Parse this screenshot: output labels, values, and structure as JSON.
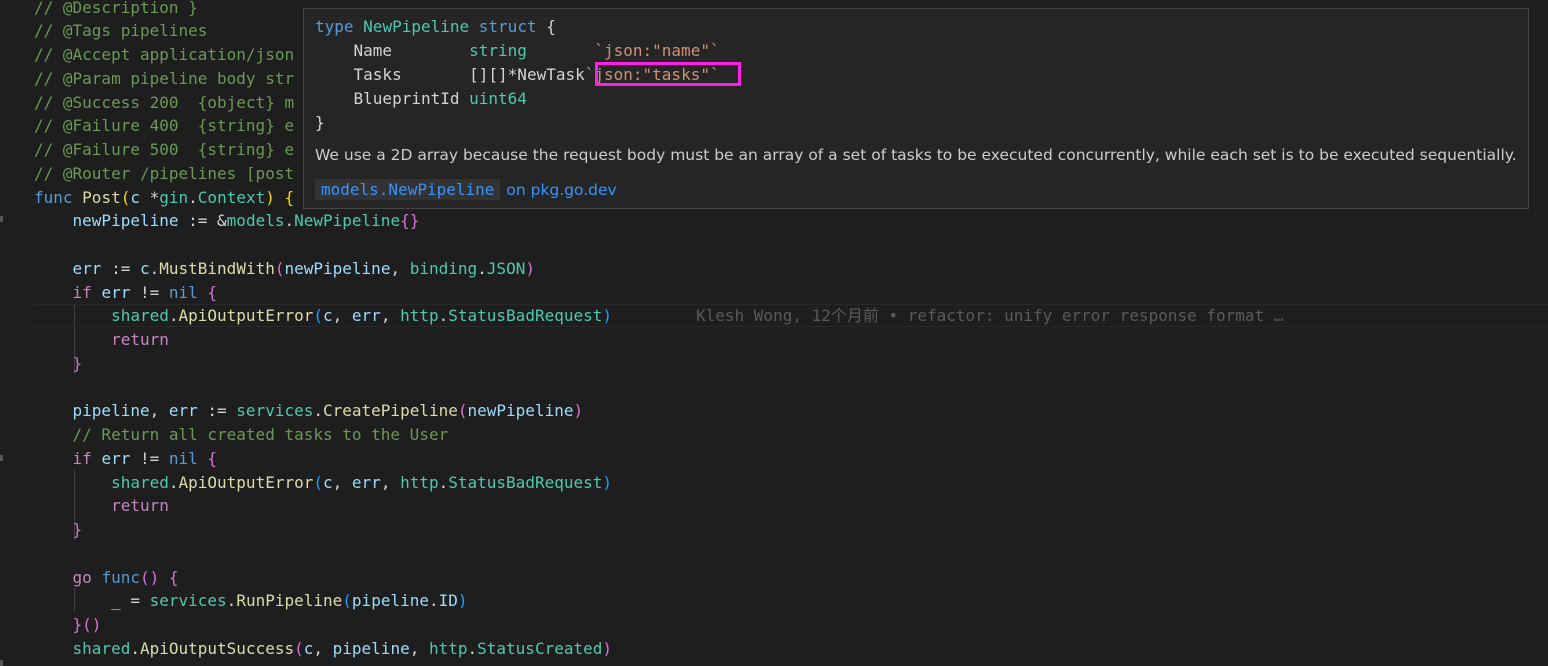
{
  "code": {
    "comments": [
      "// @Description }",
      "// @Tags pipelines",
      "// @Accept application/json",
      "// @Param pipeline body str",
      "// @Success 200  {object} m",
      "// @Failure 400  {string} e",
      "// @Failure 500  {string} e",
      "// @Router /pipelines [post"
    ],
    "func_kw": "func",
    "func_name": "Post",
    "param_c": "c",
    "param_pkg": "gin",
    "param_type": "Context",
    "new_pipeline_var": "newPipeline",
    "models_pkg": "models",
    "new_pipeline_type": "NewPipeline",
    "err_var": "err",
    "must_bind": "MustBindWith",
    "binding_pkg": "binding",
    "json_const": "JSON",
    "if_kw": "if",
    "nil_kw": "nil",
    "shared_pkg": "shared",
    "api_output_error": "ApiOutputError",
    "http_pkg": "http",
    "status_bad_request": "StatusBadRequest",
    "return_kw": "return",
    "pipeline_var": "pipeline",
    "services_pkg": "services",
    "create_pipeline": "CreatePipeline",
    "return_comment": "// Return all created tasks to the User",
    "go_kw": "go",
    "run_pipeline": "RunPipeline",
    "id_field": "ID",
    "api_output_success": "ApiOutputSuccess",
    "status_created": "StatusCreated"
  },
  "blame": "Klesh Wong, 12个月前 • refactor: unify error response format …",
  "hover": {
    "type_kw": "type",
    "type_name": "NewPipeline",
    "struct_kw": "struct",
    "field_name": "Name",
    "field_name_type": "string",
    "field_name_tag": "`json:\"name\"`",
    "field_tasks": "Tasks",
    "field_tasks_type": "[][]*NewTask",
    "field_tasks_tag": "`json:\"tasks\"`",
    "field_blueprint": "BlueprintId",
    "field_blueprint_type": "uint64",
    "close_brace": "}",
    "description": "We use a 2D array because the request body must be an array of a set of tasks to be executed concurrently, while each set is to be executed sequentially.",
    "link_symbol": "models.NewPipeline",
    "link_text": "on pkg.go.dev"
  },
  "colors": {
    "background": "#1e1e1e",
    "comment": "#6a9955",
    "keyword": "#569cd6",
    "function": "#dcdcaa",
    "type": "#4ec9b0",
    "string": "#ce9178",
    "highlight": "#ff1fe6",
    "link": "#3794ff"
  }
}
